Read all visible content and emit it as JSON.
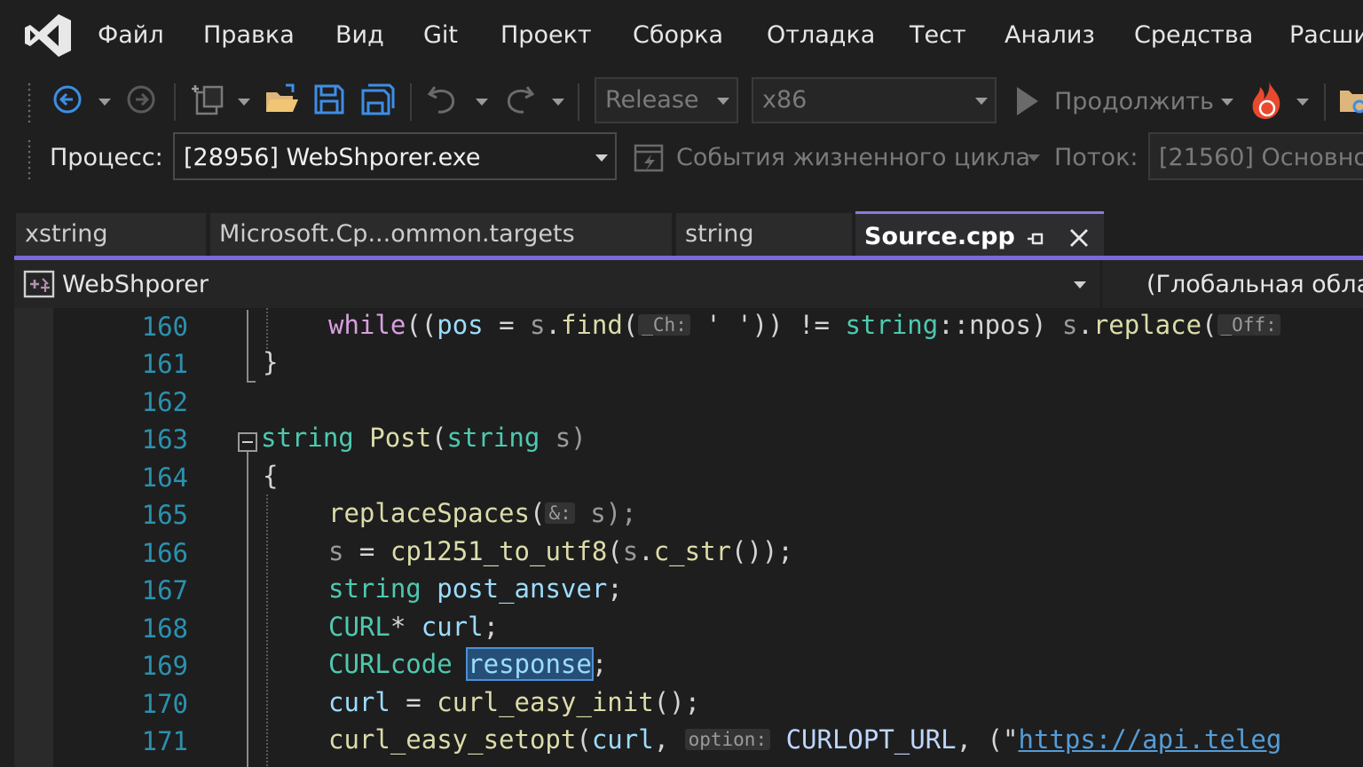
{
  "menu": [
    "Файл",
    "Правка",
    "Вид",
    "Git",
    "Проект",
    "Сборка",
    "Отладка",
    "Тест",
    "Анализ",
    "Средства",
    "Расши"
  ],
  "toolbar": {
    "config": "Release",
    "platform": "x86",
    "continue_label": "Продолжить"
  },
  "debug": {
    "process_label": "Процесс:",
    "process_value": "[28956] WebShporer.exe",
    "lifecycle_label": "События жизненного цикла",
    "thread_label": "Поток:",
    "thread_value": "[21560] Основно"
  },
  "tabs": [
    {
      "label": "xstring"
    },
    {
      "label": "Microsoft.Cp...ommon.targets"
    },
    {
      "label": "string"
    },
    {
      "label": "Source.cpp",
      "active": true
    }
  ],
  "navbar": {
    "project": "WebShporer",
    "scope": "(Глобальная обла"
  },
  "code": {
    "line_numbers": [
      "160",
      "161",
      "162",
      "163",
      "164",
      "165",
      "166",
      "167",
      "168",
      "169",
      "170",
      "171"
    ],
    "l160": {
      "a": "while",
      "b": "((",
      "c": "pos",
      "d": " = ",
      "e": "s",
      "f": ".",
      "g": "find",
      "h": "(",
      "hint1": "_Ch:",
      "i": " ' ')) != ",
      "j": "string",
      "k": "::npos) ",
      "l": "s",
      "m": ".",
      "n": "replace",
      "o": "(",
      "hint2": "_Off:"
    },
    "l161": "}",
    "l163": {
      "a": "string",
      "b": " ",
      "c": "Post",
      "d": "(",
      "e": "string",
      "f": " s)"
    },
    "l164": "{",
    "l165": {
      "a": "replaceSpaces",
      "b": "(",
      "hint": "&:",
      "c": " s);"
    },
    "l166": {
      "a": "s",
      "b": " = ",
      "c": "cp1251_to_utf8",
      "d": "(",
      "e": "s",
      "f": ".",
      "g": "c_str",
      "h": "());"
    },
    "l167": {
      "a": "string",
      "b": " ",
      "c": "post_ansver",
      "d": ";"
    },
    "l168": {
      "a": "CURL",
      "b": "* ",
      "c": "curl",
      "d": ";"
    },
    "l169": {
      "a": "CURLcode",
      "b": " ",
      "c": "response",
      "d": ";"
    },
    "l170": {
      "a": "curl",
      "b": " = ",
      "c": "curl_easy_init",
      "d": "();"
    },
    "l171": {
      "a": "curl_easy_setopt",
      "b": "(",
      "c": "curl",
      "d": ", ",
      "hint": "option:",
      "e": " ",
      "f": "CURLOPT_URL",
      "g": ", (\"",
      "h": "https://api.teleg"
    }
  }
}
